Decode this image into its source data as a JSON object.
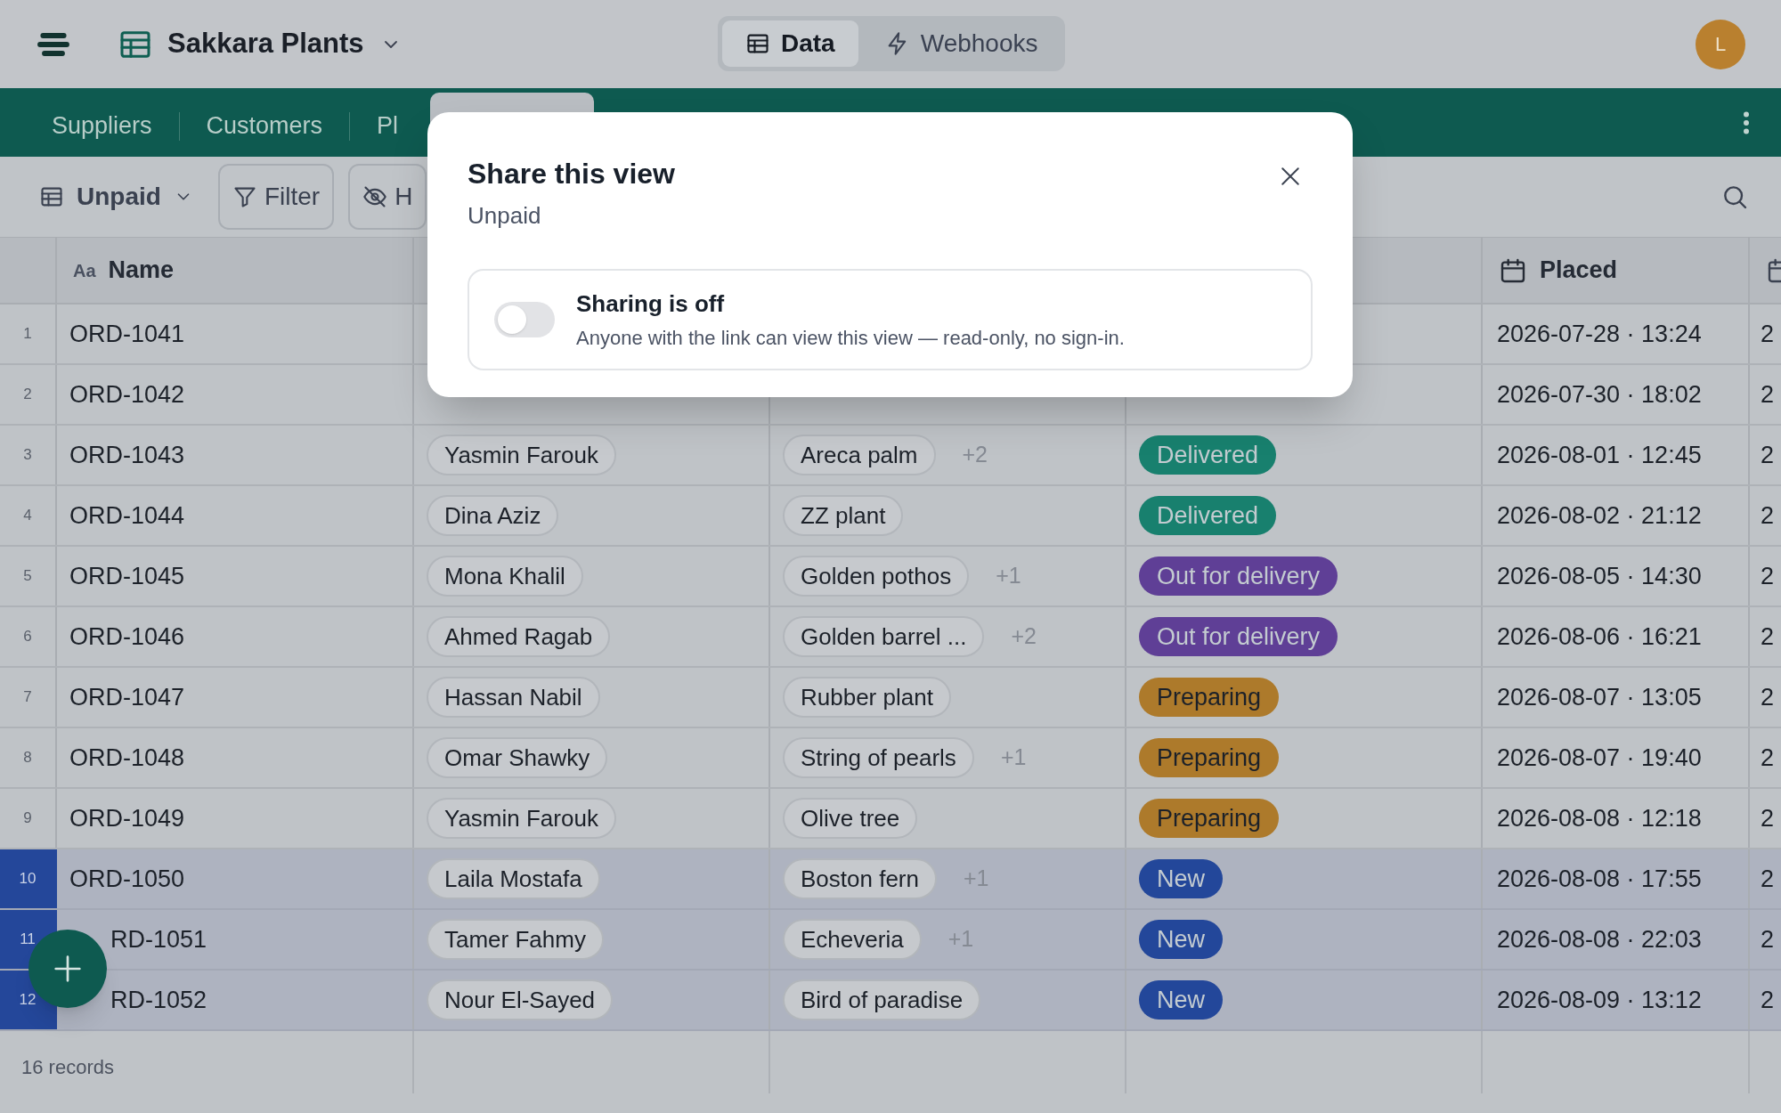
{
  "app": {
    "title": "Sakkara Plants",
    "avatar": "L"
  },
  "segments": [
    {
      "label": "Data",
      "selected": true
    },
    {
      "label": "Webhooks",
      "selected": false
    }
  ],
  "tabs": [
    {
      "label": "Suppliers",
      "selected": false
    },
    {
      "label": "Customers",
      "selected": false
    },
    {
      "label": "Pl",
      "selected": false
    },
    {
      "selected": true
    }
  ],
  "toolbar": {
    "view": "Unpaid",
    "buttons": [
      {
        "kind": "filter",
        "label": "Filter"
      },
      {
        "kind": "hide",
        "label": "H"
      }
    ]
  },
  "table": {
    "columns": [
      {
        "kind": "text",
        "label": "Name",
        "type_mark": "Aa"
      },
      {
        "kind": "date",
        "label": "Placed"
      }
    ],
    "rows": [
      {
        "number": "1",
        "selected": false,
        "name": "ORD-1041",
        "placed": "2026-07-28 · 13:24",
        "column_6": "2"
      },
      {
        "number": "2",
        "selected": false,
        "name": "ORD-1042",
        "placed": "2026-07-30 · 18:02",
        "column_6": "2"
      },
      {
        "number": "3",
        "selected": false,
        "name": "ORD-1043",
        "customer": "Yasmin Farouk",
        "item": "Areca palm",
        "more": "+2",
        "status": {
          "label": "Delivered",
          "color": "#18806e"
        },
        "placed": "2026-08-01 · 12:45",
        "column_6": "2"
      },
      {
        "number": "4",
        "selected": false,
        "name": "ORD-1044",
        "customer": "Dina Aziz",
        "item": "ZZ plant",
        "status": {
          "label": "Delivered",
          "color": "#18806e"
        },
        "placed": "2026-08-02 · 21:12",
        "column_6": "2"
      },
      {
        "number": "5",
        "selected": false,
        "name": "ORD-1045",
        "customer": "Mona Khalil",
        "item": "Golden pothos",
        "more": "+1",
        "status": {
          "label": "Out for delivery",
          "color": "#5f3f96"
        },
        "placed": "2026-08-05 · 14:30",
        "column_6": "2"
      },
      {
        "number": "6",
        "selected": false,
        "name": "ORD-1046",
        "customer": "Ahmed Ragab",
        "item": "Golden barrel ...",
        "more": "+2",
        "status": {
          "label": "Out for delivery",
          "color": "#5f3f96"
        },
        "placed": "2026-08-06 · 16:21",
        "column_6": "2"
      },
      {
        "number": "7",
        "selected": false,
        "name": "ORD-1047",
        "customer": "Hassan Nabil",
        "item": "Rubber plant",
        "status": {
          "label": "Preparing",
          "color": "#ad7a2b"
        },
        "placed": "2026-08-07 · 13:05",
        "column_6": "2"
      },
      {
        "number": "8",
        "selected": false,
        "name": "ORD-1048",
        "customer": "Omar Shawky",
        "item": "String of pearls",
        "more": "+1",
        "status": {
          "label": "Preparing",
          "color": "#ad7a2b"
        },
        "placed": "2026-08-07 · 19:40",
        "column_6": "2"
      },
      {
        "number": "9",
        "selected": false,
        "name": "ORD-1049",
        "customer": "Yasmin Farouk",
        "item": "Olive tree",
        "status": {
          "label": "Preparing",
          "color": "#ad7a2b"
        },
        "placed": "2026-08-08 · 12:18",
        "column_6": "2"
      },
      {
        "number": "10",
        "selected": true,
        "name": "ORD-1050",
        "customer": "Laila Mostafa",
        "item": "Boston fern",
        "more": "+1",
        "status": {
          "label": "New",
          "color": "#23479a"
        },
        "placed": "2026-08-08 · 17:55",
        "column_6": "2"
      },
      {
        "number": "11",
        "selected": true,
        "name": "RD-1051",
        "customer": "Tamer Fahmy",
        "item": "Echeveria",
        "more": "+1",
        "status": {
          "label": "New",
          "color": "#23479a"
        },
        "placed": "2026-08-08 · 22:03",
        "column_6": "2"
      },
      {
        "number": "12",
        "selected": true,
        "name": "RD-1052",
        "customer": "Nour El-Sayed",
        "item": "Bird of paradise",
        "status": {
          "label": "New",
          "color": "#23479a"
        },
        "placed": "2026-08-09 · 13:12",
        "column_6": "2"
      }
    ]
  },
  "footer": {
    "count": "16 records"
  },
  "modal": {
    "title": "Share this view",
    "subtitle": "Unpaid",
    "sharing": {
      "on": false,
      "title": "Sharing is off",
      "description": "Anyone with the link can view this view — read-only, no sign-in."
    }
  }
}
